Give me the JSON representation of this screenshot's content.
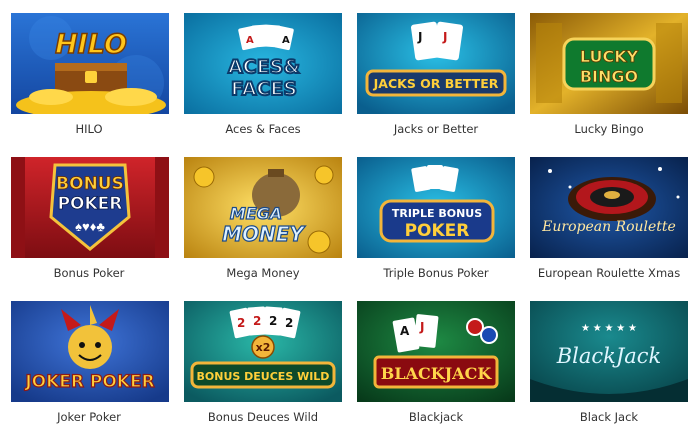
{
  "games": [
    {
      "title": "HILO",
      "art": "HILO"
    },
    {
      "title": "Aces & Faces",
      "art_line1": "ACES&",
      "art_line2": "FACES"
    },
    {
      "title": "Jacks or Better",
      "art": "JACKS OR BETTER"
    },
    {
      "title": "Lucky Bingo",
      "art_line1": "LUCKY",
      "art_line2": "BINGO"
    },
    {
      "title": "Bonus Poker",
      "art_line1": "BONUS",
      "art_line2": "POKER"
    },
    {
      "title": "Mega Money",
      "art_line1": "MEGA",
      "art_line2": "MONEY"
    },
    {
      "title": "Triple Bonus Poker",
      "art_line1": "TRIPLE BONUS",
      "art_line2": "POKER"
    },
    {
      "title": "European Roulette Xmas",
      "art": "European Roulette"
    },
    {
      "title": "Joker Poker",
      "art": "JOKER POKER"
    },
    {
      "title": "Bonus Deuces Wild",
      "art": "BONUS DEUCES WILD",
      "badge": "x2"
    },
    {
      "title": "Blackjack",
      "art": "BLACKJACK"
    },
    {
      "title": "Black Jack",
      "art": "BlackJack"
    }
  ],
  "colors": {
    "label": "#333333",
    "tile_hilo": "#1f5fc4",
    "tile_teal": "#118fbf",
    "tile_gold": "#c99a1d",
    "tile_red": "#b3171c",
    "tile_green": "#0d5a2a",
    "tile_darkteal": "#0c5f66"
  }
}
